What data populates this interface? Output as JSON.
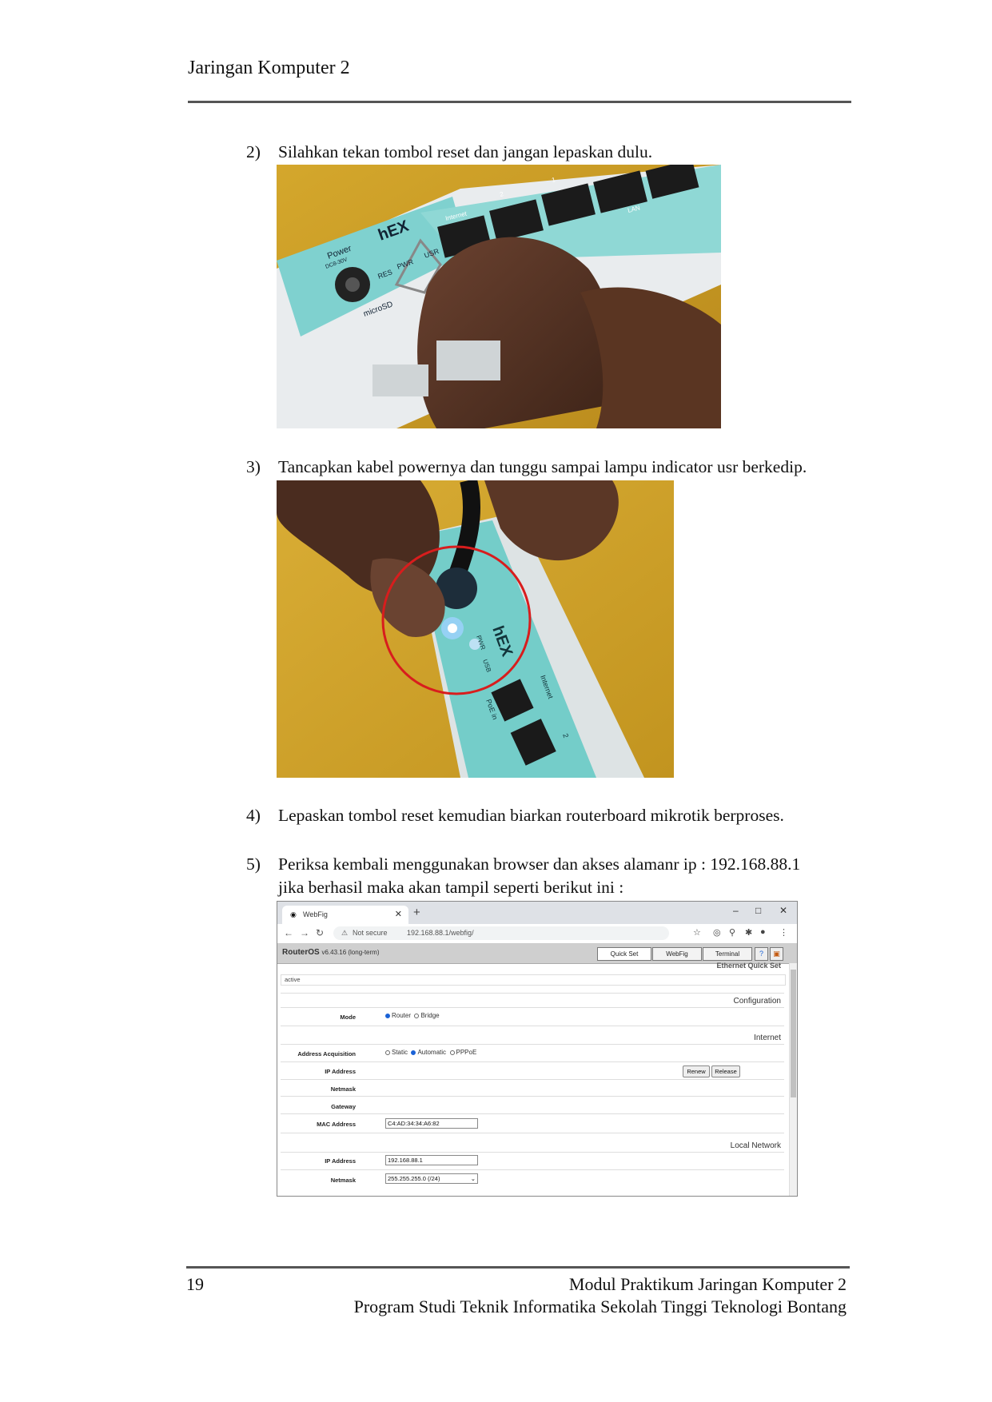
{
  "header": {
    "title": "Jaringan Komputer 2"
  },
  "steps": [
    {
      "num": "2)",
      "text": "Silahkan tekan tombol reset dan jangan lepaskan dulu."
    },
    {
      "num": "3)",
      "text": "Tancapkan kabel powernya dan tunggu sampai lampu indicator usr berkedip."
    },
    {
      "num": "4)",
      "text": "Lepaskan tombol reset kemudian biarkan routerboard mikrotik berproses."
    },
    {
      "num": "5)",
      "text": "Periksa kembali menggunakan browser dan akses alamanr ip : 192.168.88.1",
      "text2": "jika berhasil maka akan tampil seperti berikut ini :"
    }
  ],
  "photo1": {
    "labels": {
      "brand": "hEX",
      "power": "Power",
      "dc": "DC8-30V",
      "res": "RES",
      "pwr": "PWR",
      "usr": "USR",
      "microsd": "microSD",
      "internet": "Internet",
      "p2": "2",
      "p1": "1",
      "lan": "LAN"
    }
  },
  "photo2": {
    "labels": {
      "brand": "hEX",
      "pwr": "PWR",
      "usb": "USB",
      "internet": "Internet",
      "poe": "PoE in",
      "p2": "2"
    }
  },
  "browser": {
    "tab_title": "WebFig",
    "url_warning": "Not secure",
    "url": "192.168.88.1/webfig/",
    "app_title": "RouterOS",
    "app_version": "v6.43.16 (long-term)",
    "tabs": [
      "Quick Set",
      "WebFig",
      "Terminal"
    ],
    "panel_title": "Ethernet Quick Set",
    "status": "active",
    "sections": {
      "configuration": "Configuration",
      "internet": "Internet",
      "local": "Local Network"
    },
    "mode": {
      "label": "Mode",
      "options": [
        "Router",
        "Bridge"
      ]
    },
    "acq": {
      "label": "Address Acquisition",
      "options": [
        "Static",
        "Automatic",
        "PPPoE"
      ]
    },
    "ip_label": "IP Address",
    "netmask_label": "Netmask",
    "gateway_label": "Gateway",
    "mac_label": "MAC Address",
    "mac_value": "C4:AD:34:34:A6:82",
    "renew": "Renew",
    "release": "Release",
    "lan_ip_label": "IP Address",
    "lan_ip_value": "192.168.88.1",
    "lan_netmask_label": "Netmask",
    "lan_netmask_value": "255.255.255.0 (/24)"
  },
  "footer": {
    "page": "19",
    "line1": "Modul Praktikum Jaringan Komputer 2",
    "line2": "Program Studi Teknik Informatika Sekolah Tinggi Teknologi Bontang"
  }
}
